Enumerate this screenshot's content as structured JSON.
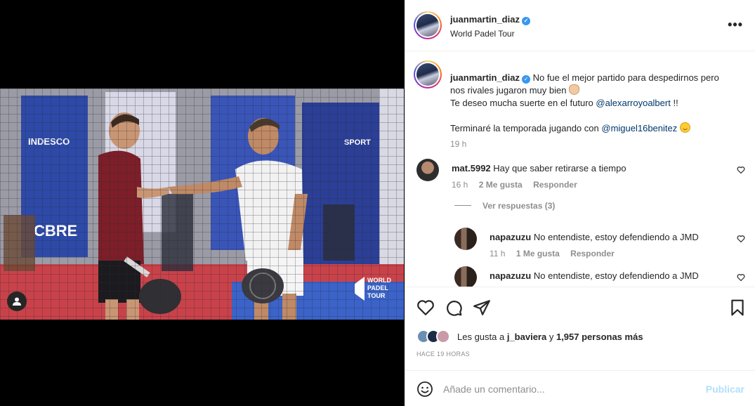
{
  "post": {
    "username": "juanmartin_diaz",
    "location": "World Padel Tour",
    "more_icon": "more-horizontal-icon",
    "photo_watermark": "WORLD\nPADEL\nTOUR"
  },
  "caption": {
    "username": "juanmartin_diaz",
    "line1": "No fue el mejor partido para despedirnos pero nos rivales jugaron muy bien",
    "line2_prefix": "Te deseo mucha suerte en el futuro",
    "line2_mention": "@alexarroyoalbert",
    "line2_suffix": "!!",
    "line3_prefix": "Terminaré la temporada jugando con",
    "line3_mention": "@miguel16benitez",
    "time": "19 h"
  },
  "comments": [
    {
      "username": "mat.5992",
      "text": "Hay que saber retirarse a tiempo",
      "time": "16 h",
      "likes": "2 Me gusta",
      "reply": "Responder"
    }
  ],
  "view_replies": "Ver respuestas (3)",
  "replies": [
    {
      "username": "napazuzu",
      "text": "No entendiste, estoy defendiendo a JMD",
      "time": "11 h",
      "likes": "1 Me gusta",
      "reply": "Responder"
    },
    {
      "username": "napazuzu",
      "text": "No entendiste, estoy defendiendo a JMD"
    }
  ],
  "likes": {
    "prefix": "Les gusta a",
    "user": "j_baviera",
    "middle": "y",
    "count": "1,957 personas más"
  },
  "time_ago": "HACE 19 HORAS",
  "add_comment": {
    "placeholder": "Añade un comentario...",
    "post_label": "Publicar"
  },
  "colors": {
    "mention": "#00376b",
    "muted": "#8e8e8e",
    "post_disabled": "#b2dffc",
    "verified": "#3897f0"
  }
}
